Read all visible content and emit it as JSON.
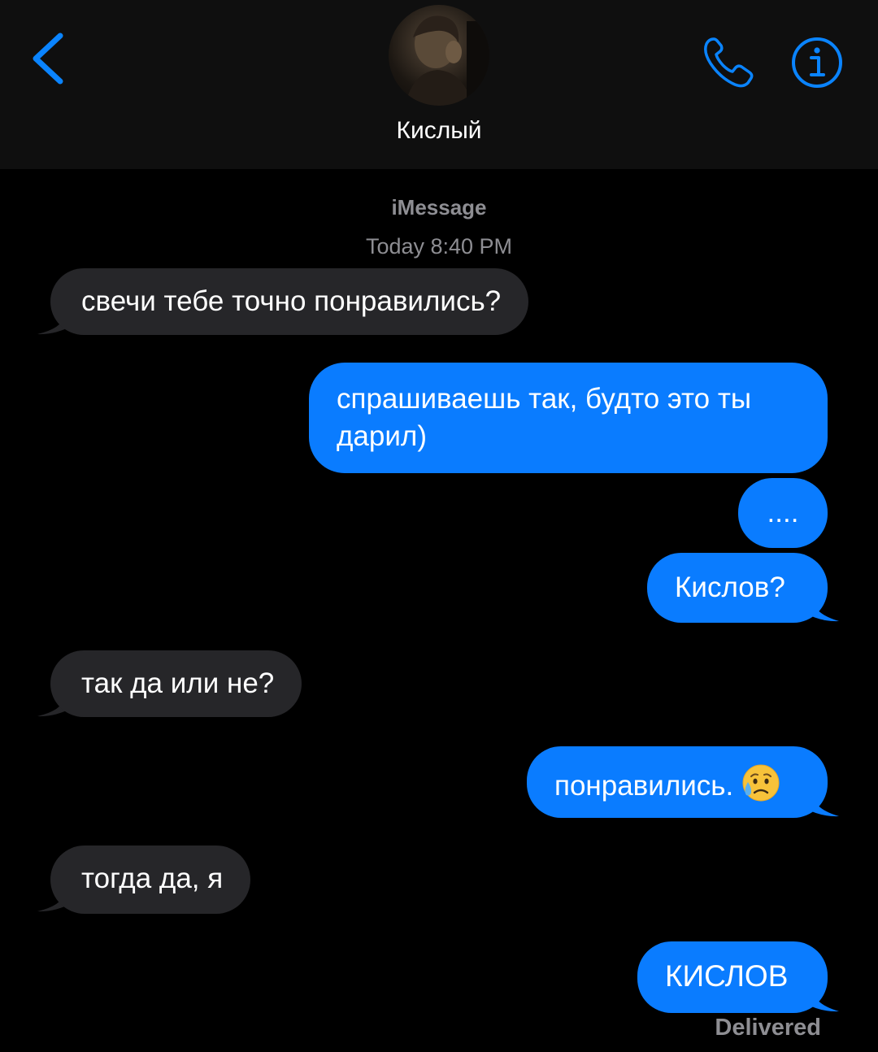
{
  "header": {
    "contact_name": "Кислый",
    "back_icon": "chevron-left-icon",
    "phone_icon": "phone-icon",
    "info_icon": "info-icon"
  },
  "conversation": {
    "service": "iMessage",
    "timestamp": "Today 8:40 PM",
    "messages": [
      {
        "direction": "incoming",
        "text": "свечи тебе точно понравились?"
      },
      {
        "direction": "outgoing",
        "lines": [
          "спрашиваешь так, будто это ты",
          "дарил)"
        ]
      },
      {
        "direction": "outgoing",
        "text": "...."
      },
      {
        "direction": "outgoing",
        "text": "Кислов?"
      },
      {
        "direction": "incoming",
        "text": "так да или не?"
      },
      {
        "direction": "outgoing",
        "text": "понравились.",
        "emoji": "sad-but-relieved-face"
      },
      {
        "direction": "incoming",
        "text": "тогда да, я"
      },
      {
        "direction": "outgoing",
        "text": "КИСЛОВ"
      }
    ],
    "status": "Delivered"
  },
  "colors": {
    "accent": "#0a7cff",
    "incoming_bubble": "#262629",
    "header_bg": "#0f0f0f",
    "meta_text": "#8e8e93"
  }
}
